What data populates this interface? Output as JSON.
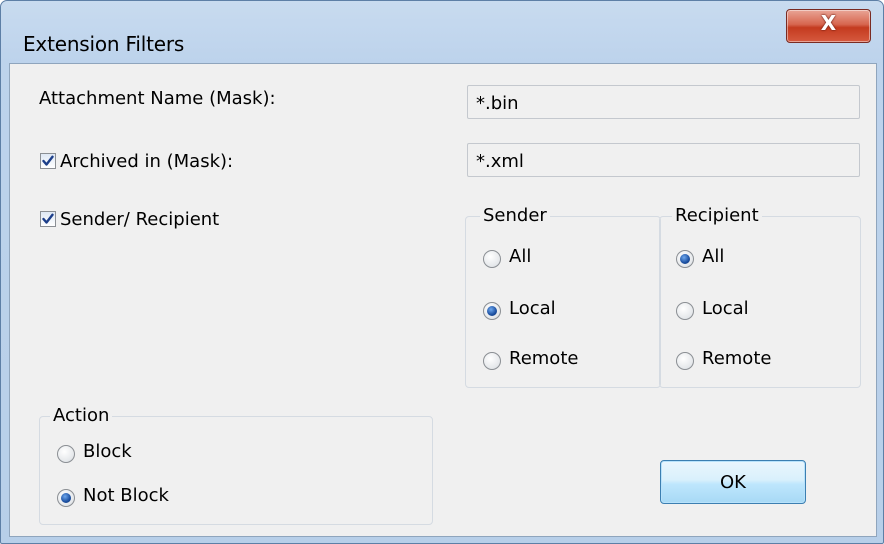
{
  "window": {
    "title": "Extension Filters",
    "close_label": "X"
  },
  "fields": {
    "attachment_name_label": "Attachment Name (Mask):",
    "attachment_name_value": "*.bin",
    "archived_in_label": "Archived in (Mask):",
    "archived_in_value": "*.xml",
    "archived_in_checked": true,
    "sender_recipient_label": "Sender/ Recipient",
    "sender_recipient_checked": true
  },
  "sender": {
    "title": "Sender",
    "options": [
      "All",
      "Local",
      "Remote"
    ],
    "selected": "Local"
  },
  "recipient": {
    "title": "Recipient",
    "options": [
      "All",
      "Local",
      "Remote"
    ],
    "selected": "All"
  },
  "action": {
    "title": "Action",
    "options": [
      "Block",
      "Not Block"
    ],
    "selected": "Not Block"
  },
  "buttons": {
    "ok_label": "OK"
  },
  "colors": {
    "titlebar": "#bdd3ec",
    "client": "#f0f0f0",
    "close_button": "#c43b1f",
    "radio_selected": "#1b4fa0"
  }
}
